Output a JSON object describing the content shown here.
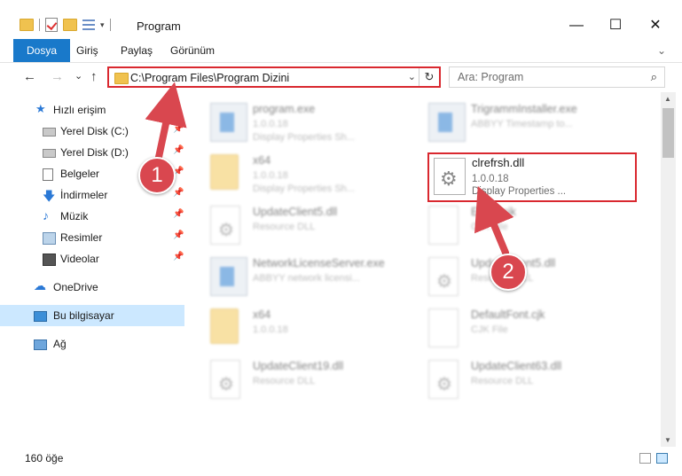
{
  "window": {
    "title": "Program",
    "controls": [
      "—",
      "☐",
      "✕"
    ]
  },
  "ribbon": {
    "tabs": [
      "Dosya",
      "Giriş",
      "Paylaş",
      "Görünüm"
    ]
  },
  "nav": {
    "back": "←",
    "forward": "→",
    "recent": "⌄",
    "up": "↑",
    "address_path": "C:\\Program Files\\Program Dizini",
    "search_placeholder": "Ara: Program"
  },
  "sidebar": {
    "items": [
      {
        "label": "Hızlı erişim"
      },
      {
        "label": "Yerel Disk (C:)"
      },
      {
        "label": "Yerel Disk (D:)"
      },
      {
        "label": "Belgeler"
      },
      {
        "label": "İndirmeler"
      },
      {
        "label": "Müzik"
      },
      {
        "label": "Resimler"
      },
      {
        "label": "Videolar"
      },
      {
        "label": "OneDrive"
      },
      {
        "label": "Bu bilgisayar"
      },
      {
        "label": "Ağ"
      }
    ]
  },
  "files": [
    {
      "name": "program.exe",
      "version": "1.0.0.18",
      "desc": "Display Properties Sh..."
    },
    {
      "name": "x64",
      "version": "1.0.0.18",
      "desc": "Display Properties Sh..."
    },
    {
      "name": "UpdateClient5.dll",
      "version": "",
      "desc": "Resource DLL"
    },
    {
      "name": "NetworkLicenseServer.exe",
      "version": "",
      "desc": "ABBYY network licensi..."
    },
    {
      "name": "x64",
      "version": "1.0.0.18",
      "desc": ""
    },
    {
      "name": "UpdateClient19.dll",
      "version": "",
      "desc": "Resource DLL"
    },
    {
      "name": "TrigrammInstaller.exe",
      "version": "",
      "desc": "ABBYY Timestamp to..."
    },
    {
      "name": "Ecom.cjk",
      "version": "",
      "desc": "CJK File"
    },
    {
      "name": "UpdateClient5.dll",
      "version": "",
      "desc": "Resource DLL"
    },
    {
      "name": "DefaultFont.cjk",
      "version": "",
      "desc": "CJK File"
    },
    {
      "name": "UpdateClient63.dll",
      "version": "",
      "desc": "Resource DLL"
    }
  ],
  "highlighted_file": {
    "name": "clrefrsh.dll",
    "version": "1.0.0.18",
    "desc": "Display Properties ..."
  },
  "markers": [
    "1",
    "2"
  ],
  "status": {
    "count": "160 öğe"
  },
  "colors": {
    "accent": "#1979ca",
    "annotation": "#d9474f",
    "selection": "#cce8ff"
  }
}
